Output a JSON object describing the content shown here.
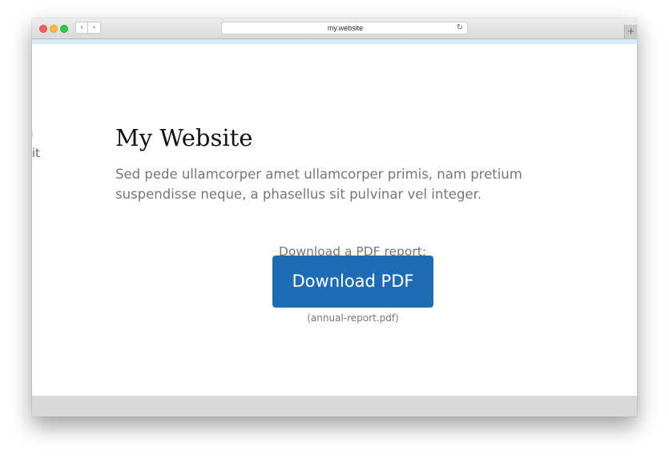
{
  "browser": {
    "url": "my.website",
    "back_glyph": "‹",
    "forward_glyph": "›",
    "reload_glyph": "↻",
    "new_tab_glyph": "+",
    "icons": [
      "back-arrow-icon",
      "forward-arrow-icon",
      "reload-icon",
      "plus-icon"
    ],
    "traffic_lights": {
      "close": "#fc605c",
      "minimize": "#fdbc40",
      "zoom": "#34c84a"
    }
  },
  "page": {
    "partial_edge_line_1": "n",
    "partial_edge_line_2": "sit",
    "title": "My Website",
    "intro": "Sed pede ullamcorper amet ullamcorper primis, nam pretium suspendisse neque, a phasellus sit pulvinar vel integer.",
    "download_prompt": "Download a PDF report:",
    "download_button_label": "Download PDF",
    "download_filename": "(annual-report.pdf)"
  },
  "colors": {
    "accent_bar": "#d6ecf8",
    "button": "#1e6db4",
    "body_text": "#767676",
    "heading": "#111111"
  }
}
